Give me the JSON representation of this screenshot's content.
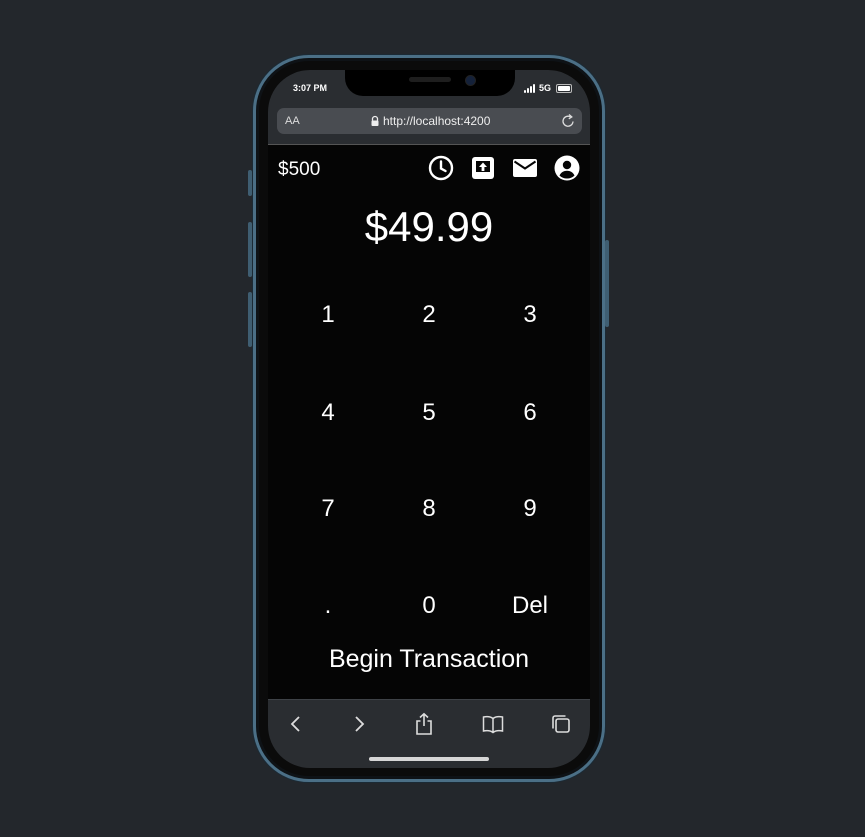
{
  "status_bar": {
    "time": "3:07 PM",
    "network": "5G"
  },
  "browser": {
    "aa_label": "AA",
    "url": "http://localhost:4200"
  },
  "app": {
    "balance": "$500",
    "amount": "$49.99",
    "header_icons": [
      "history-icon",
      "upload-icon",
      "mail-icon",
      "account-icon"
    ],
    "keypad": [
      [
        "1",
        "2",
        "3"
      ],
      [
        "4",
        "5",
        "6"
      ],
      [
        "7",
        "8",
        "9"
      ],
      [
        ".",
        "0",
        "Del"
      ]
    ],
    "begin_label": "Begin Transaction"
  },
  "toolbar": [
    "back-icon",
    "forward-icon",
    "share-icon",
    "bookmarks-icon",
    "tabs-icon"
  ],
  "colors": {
    "background": "#23272c",
    "frame": "#4b6f86",
    "app_bg": "#050505",
    "chrome": "#2a2d31",
    "text": "#ffffff"
  }
}
